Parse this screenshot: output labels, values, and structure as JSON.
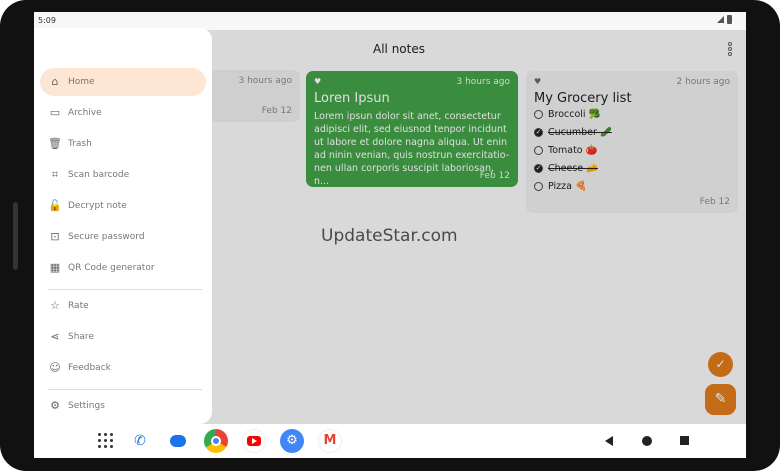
{
  "status_bar": {
    "time": "5:09"
  },
  "app_bar": {
    "title": "All notes"
  },
  "notes": [
    {
      "time": "3 hours ago",
      "date": "Feb 12"
    },
    {
      "title": "Loren Ipsun",
      "time": "3 hours ago",
      "body": "Lorem ipsun dolor sit anet, consectetur adipisci elit, sed eiusnod tenpor incidunt ut labore et dolore nagna aliqua. Ut enin ad ninin venian, quis nostrun exercitatio-nen ullan corporis suscipit laboriosan, n...",
      "date": "Feb 12",
      "color": "#43a047"
    },
    {
      "title": "My Grocery list",
      "time": "2 hours ago",
      "date": "Feb 12",
      "items": [
        {
          "text": "Broccoli 🥦",
          "checked": false
        },
        {
          "text": "Cucumber 🥒",
          "checked": true
        },
        {
          "text": "Tomato 🍅",
          "checked": false
        },
        {
          "text": "Cheese 🧀",
          "checked": true
        },
        {
          "text": "Pizza 🍕",
          "checked": false
        }
      ]
    }
  ],
  "watermark": "UpdateStar.com",
  "drawer": {
    "items": [
      {
        "label": "Home",
        "icon": "home-icon",
        "active": true
      },
      {
        "label": "Archive",
        "icon": "archive-icon"
      },
      {
        "label": "Trash",
        "icon": "trash-icon"
      },
      {
        "label": "Scan barcode",
        "icon": "scan-barcode-icon"
      },
      {
        "label": "Decrypt note",
        "icon": "unlock-icon"
      },
      {
        "label": "Secure password",
        "icon": "password-icon"
      },
      {
        "label": "QR Code generator",
        "icon": "qr-code-icon"
      },
      {
        "label": "Rate",
        "icon": "star-icon"
      },
      {
        "label": "Share",
        "icon": "share-icon"
      },
      {
        "label": "Feedback",
        "icon": "feedback-icon"
      },
      {
        "label": "Settings",
        "icon": "gear-icon"
      }
    ]
  },
  "colors": {
    "accent": "#e07a1c",
    "active_bg": "#fde6d4",
    "note_green": "#43a047"
  }
}
